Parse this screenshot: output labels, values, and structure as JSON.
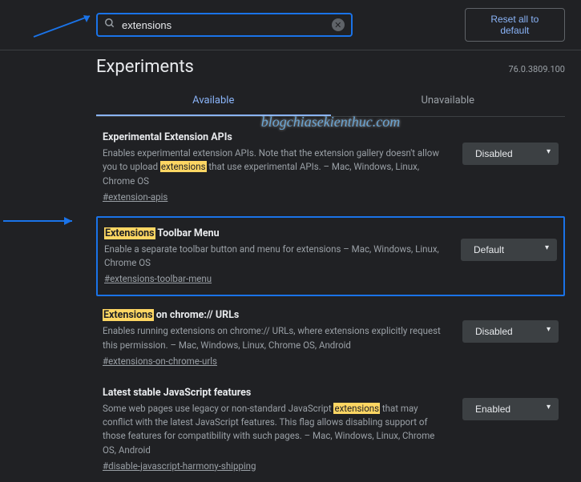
{
  "header": {
    "search_value": "extensions ",
    "reset_label": "Reset all to default"
  },
  "page": {
    "title": "Experiments",
    "version": "76.0.3809.100"
  },
  "tabs": {
    "available": "Available",
    "unavailable": "Unavailable"
  },
  "watermark": "blogchiasekienthuc.com",
  "flags": [
    {
      "title_pre": "Experimental Extension APIs",
      "desc_pre": "Enables experimental extension APIs. Note that the extension gallery doesn't allow you to upload ",
      "desc_hl": "extensions",
      "desc_post": " that use experimental APIs. – Mac, Windows, Linux, Chrome OS",
      "hash": "#extension-apis",
      "select": "Disabled"
    },
    {
      "title_hl": "Extensions",
      "title_post": " Toolbar Menu",
      "desc_plain": "Enable a separate toolbar button and menu for extensions – Mac, Windows, Linux, Chrome OS",
      "hash": "#extensions-toolbar-menu",
      "select": "Default"
    },
    {
      "title_hl": "Extensions",
      "title_post": " on chrome:// URLs",
      "desc_plain": "Enables running extensions on chrome:// URLs, where extensions explicitly request this permission. – Mac, Windows, Linux, Chrome OS, Android",
      "hash": "#extensions-on-chrome-urls",
      "select": "Disabled"
    },
    {
      "title_pre": "Latest stable JavaScript features",
      "desc_pre": "Some web pages use legacy or non-standard JavaScript ",
      "desc_hl": "extensions",
      "desc_post": " that may conflict with the latest JavaScript features. This flag allows disabling support of those features for compatibility with such pages. – Mac, Windows, Linux, Chrome OS, Android",
      "hash": "#disable-javascript-harmony-shipping",
      "select": "Enabled"
    }
  ]
}
